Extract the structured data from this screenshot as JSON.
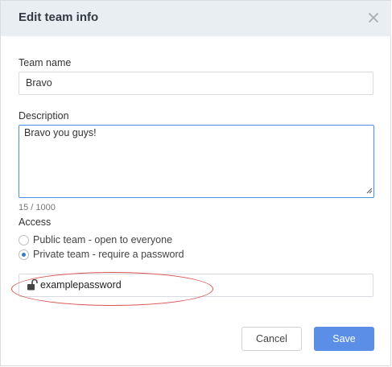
{
  "dialog": {
    "title": "Edit team info",
    "close_icon": "close-icon"
  },
  "team_name": {
    "label": "Team name",
    "value": "Bravo"
  },
  "description": {
    "label": "Description",
    "value": "Bravo you guys!",
    "counter": "15 / 1000"
  },
  "access": {
    "label": "Access",
    "options": [
      {
        "label": "Public team - open to everyone",
        "selected": false
      },
      {
        "label": "Private team - require a password",
        "selected": true
      }
    ]
  },
  "password": {
    "value": "examplepassword",
    "icon": "unlock-icon"
  },
  "buttons": {
    "cancel": "Cancel",
    "save": "Save"
  },
  "colors": {
    "accent": "#5b8ee6",
    "header_bg": "#e9eef2",
    "annotation": "#d9534f",
    "focus_border": "#4a90e2"
  }
}
